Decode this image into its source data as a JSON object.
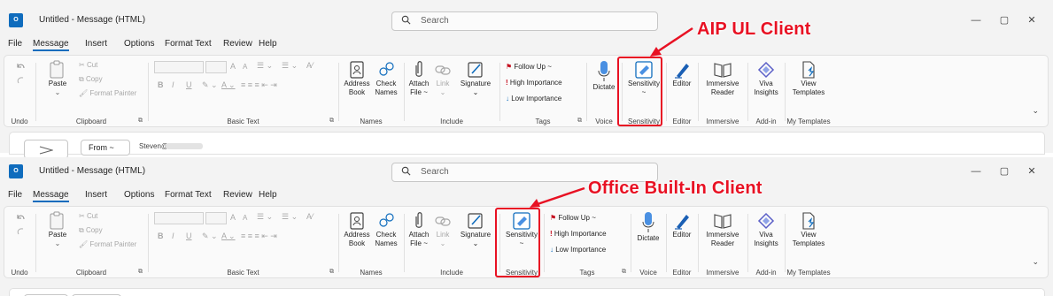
{
  "window": {
    "title": "Untitled  -  Message (HTML)",
    "app_icon": "outlook-icon",
    "search_placeholder": "Search",
    "controls": {
      "minimize": "—",
      "restore": "▢",
      "close": "✕"
    }
  },
  "menu": [
    "File",
    "Message",
    "Insert",
    "Options",
    "Format Text",
    "Review",
    "Help"
  ],
  "active_menu": "Message",
  "ribbon": {
    "undo": "Undo",
    "clipboard": {
      "paste": "Paste",
      "cut": "Cut",
      "copy": "Copy",
      "format_painter": "Format Painter",
      "label": "Clipboard"
    },
    "basic_text": {
      "label": "Basic Text",
      "bold": "B",
      "italic": "I",
      "underline": "U",
      "font_grow": "A",
      "font_shrink": "A"
    },
    "names": {
      "address_book": "Address Book",
      "address_book_l1": "Address",
      "address_book_l2": "Book",
      "check_names_l1": "Check",
      "check_names_l2": "Names",
      "label": "Names"
    },
    "include": {
      "attach_l1": "Attach",
      "attach_l2": "File ~",
      "link": "Link",
      "signature": "Signature",
      "label": "Include"
    },
    "tags": {
      "follow_up": "Follow Up ~",
      "high": "High Importance",
      "low": "Low Importance",
      "label": "Tags"
    },
    "voice": {
      "dictate": "Dictate",
      "label": "Voice"
    },
    "sensitivity": {
      "button": "Sensitivity",
      "caret": "~",
      "label": "Sensitivity"
    },
    "editor": {
      "button": "Editor",
      "label": "Editor"
    },
    "immersive": {
      "l1": "Immersive",
      "l2": "Reader",
      "label": "Immersive"
    },
    "viva": {
      "l1": "Viva",
      "l2": "Insights",
      "label": "Add-in"
    },
    "templates": {
      "l1": "View",
      "l2": "Templates",
      "label": "My Templates"
    }
  },
  "compose": {
    "from": "From ~",
    "from_value": "Steven@"
  },
  "annotations": {
    "top": "AIP UL Client",
    "bottom": "Office Built-In Client",
    "color": "#e81123"
  },
  "colors": {
    "accent": "#0f6cbd",
    "ribbon_bg": "#fafafa",
    "window_bg": "#f3f3f3"
  }
}
